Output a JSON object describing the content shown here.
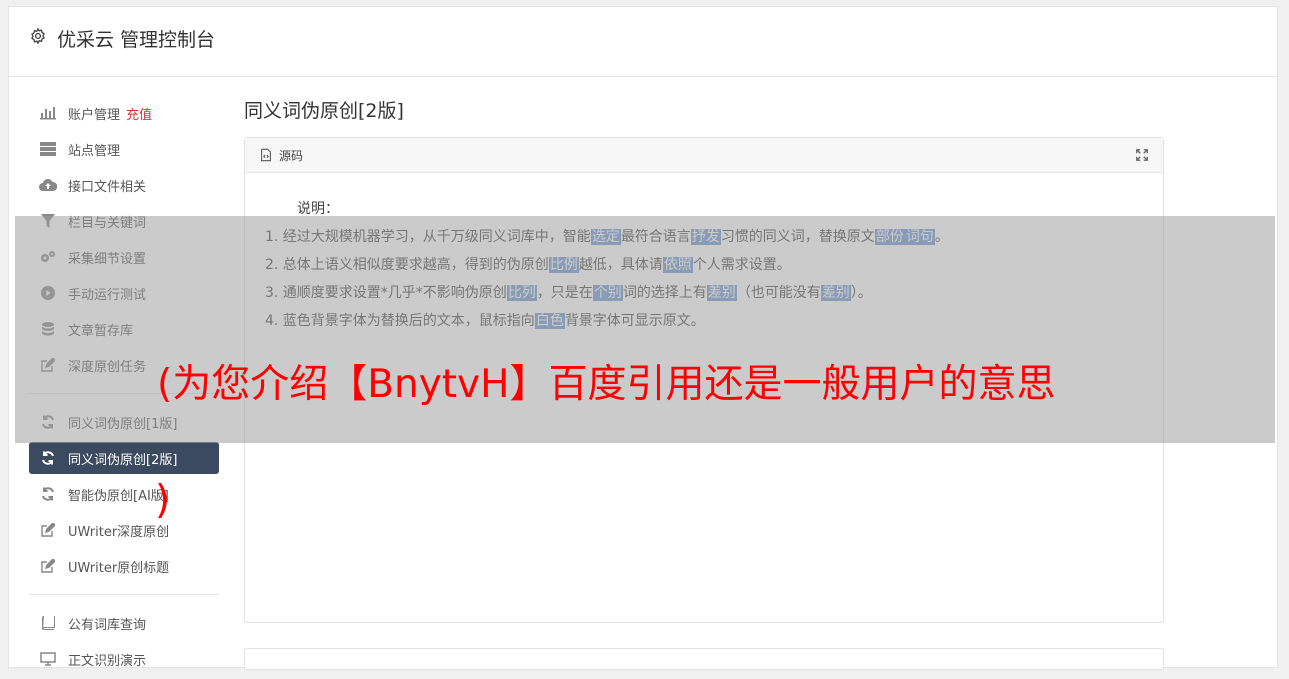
{
  "header": {
    "title": "优采云 管理控制台"
  },
  "sidebar": {
    "recharge": "充值",
    "group1": [
      {
        "label": "账户管理",
        "icon": "bar-chart-icon"
      },
      {
        "label": "站点管理",
        "icon": "server-icon"
      },
      {
        "label": "接口文件相关",
        "icon": "cloud-upload-icon"
      },
      {
        "label": "栏目与关键词",
        "icon": "filter-icon"
      },
      {
        "label": "采集细节设置",
        "icon": "gears-icon"
      },
      {
        "label": "手动运行测试",
        "icon": "play-circle-icon"
      },
      {
        "label": "文章暂存库",
        "icon": "database-icon"
      },
      {
        "label": "深度原创任务",
        "icon": "edit-icon"
      }
    ],
    "group2": [
      {
        "label": "同义词伪原创[1版]",
        "icon": "refresh-icon"
      },
      {
        "label": "同义词伪原创[2版]",
        "icon": "refresh-icon"
      },
      {
        "label": "智能伪原创[AI版]",
        "icon": "refresh-icon"
      },
      {
        "label": "UWriter深度原创",
        "icon": "edit-icon"
      },
      {
        "label": "UWriter原创标题",
        "icon": "edit-icon"
      }
    ],
    "group3": [
      {
        "label": "公有词库查询",
        "icon": "book-icon"
      },
      {
        "label": "正文识别演示",
        "icon": "monitor-icon"
      }
    ]
  },
  "main": {
    "title": "同义词伪原创[2版]",
    "panel_label": "源码",
    "intro": "说明：",
    "lines": [
      [
        "1. 经过大规模机器学习，从千万级同义词库中，智能",
        {
          "hl": "选定"
        },
        "最符合语言",
        {
          "hl": "抒发"
        },
        "习惯的同义词，替换原文",
        {
          "hl": "部份"
        },
        {
          "hl": "词句"
        },
        "。"
      ],
      [
        "2. 总体上语义相似度要求越高，得到的伪原创",
        {
          "hl": "比例"
        },
        "越低，具体请",
        {
          "hl": "依照"
        },
        "个人需求设置。"
      ],
      [
        "3. 通顺度要求设置*几乎*不影响伪原创",
        {
          "hl": "比列"
        },
        "，只是在",
        {
          "hl": "个别"
        },
        "词的选择上有",
        {
          "hl": "差别"
        },
        "（也可能没有",
        {
          "hl": "差别"
        },
        "）。"
      ],
      [
        "4. 蓝色背景字体为替换后的文本，鼠标指向",
        {
          "hl": "白色"
        },
        "背景字体可显示原文。"
      ]
    ]
  },
  "overlay": {
    "headline": "(为您介绍【BnytvH】百度引用还是一般用户的意思",
    "tail": ")"
  },
  "colors": {
    "accent": "#3b4a5e",
    "highlight": "#6c95d3",
    "alert": "#ff0000"
  }
}
